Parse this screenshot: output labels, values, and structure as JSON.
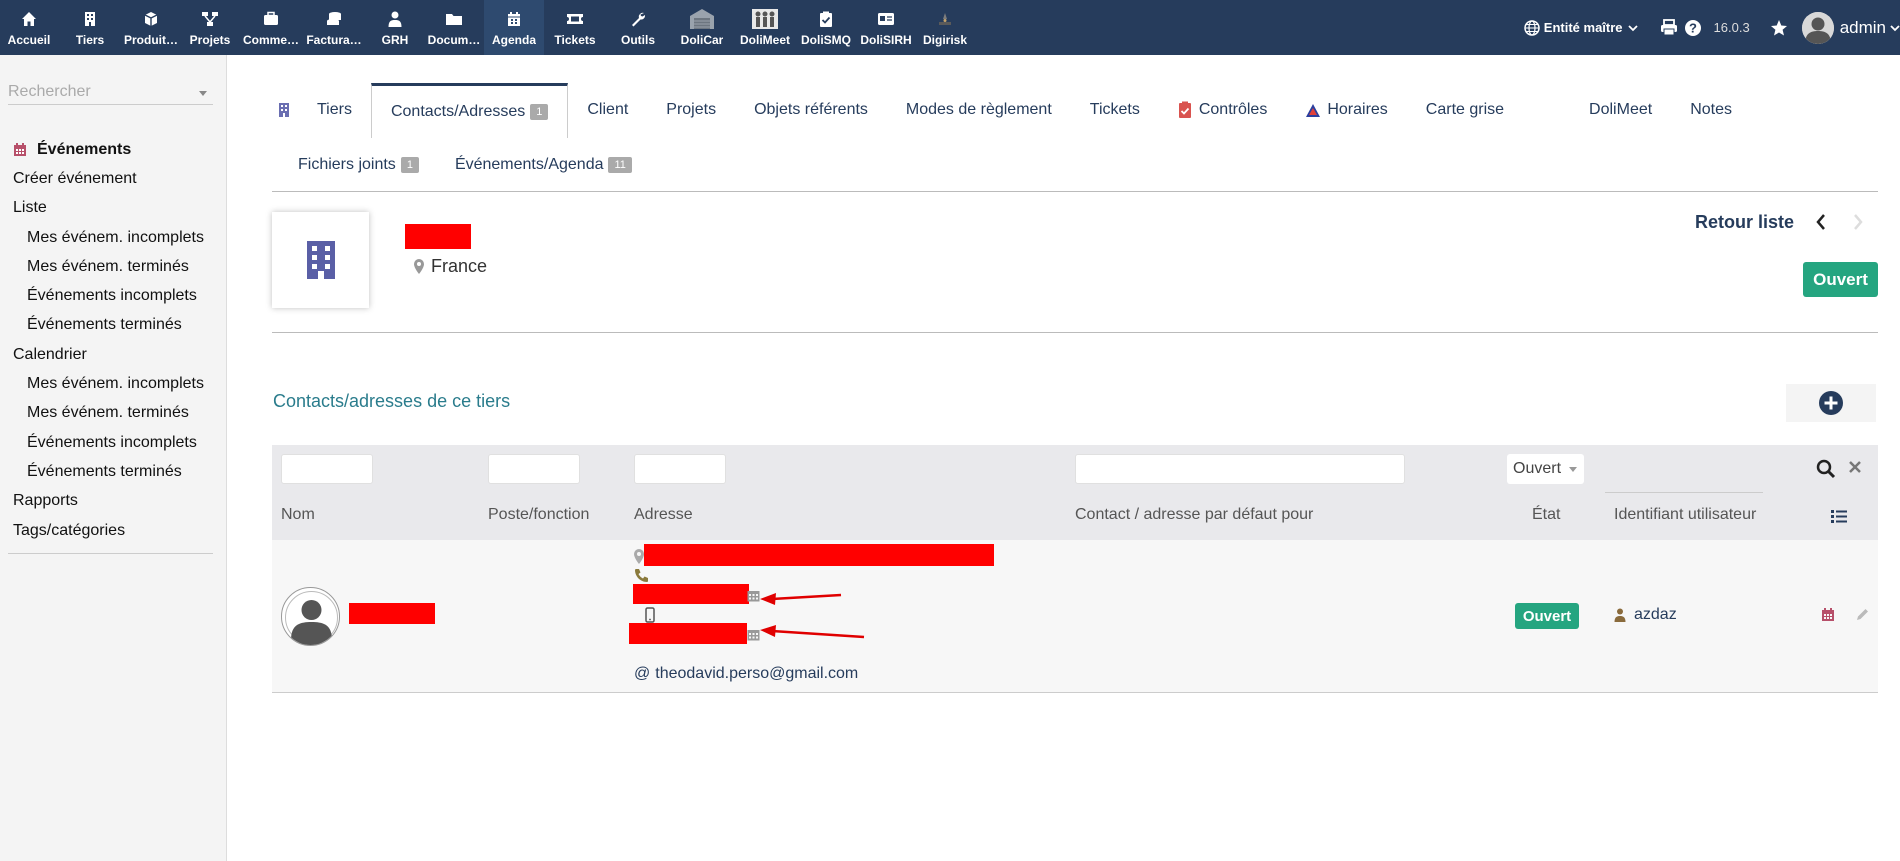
{
  "topmenu": [
    {
      "label": "Accueil",
      "icon": "home-icon"
    },
    {
      "label": "Tiers",
      "icon": "building-icon"
    },
    {
      "label": "Produit…",
      "icon": "cube-icon"
    },
    {
      "label": "Projets",
      "icon": "project-icon"
    },
    {
      "label": "Comme…",
      "icon": "suitcase-icon"
    },
    {
      "label": "Factura…",
      "icon": "coins-icon"
    },
    {
      "label": "GRH",
      "icon": "user-tie-icon"
    },
    {
      "label": "Docum…",
      "icon": "folder-icon"
    },
    {
      "label": "Agenda",
      "icon": "calendar-icon"
    },
    {
      "label": "Tickets",
      "icon": "ticket-icon"
    },
    {
      "label": "Outils",
      "icon": "wrench-icon"
    },
    {
      "label": "DoliCar",
      "icon": "garage-icon"
    },
    {
      "label": "DoliMeet",
      "icon": "meeting-icon"
    },
    {
      "label": "DoliSMQ",
      "icon": "clipboard-check-icon"
    },
    {
      "label": "DoliSIRH",
      "icon": "id-card-icon"
    },
    {
      "label": "Digirisk",
      "icon": "digirisk-icon"
    }
  ],
  "topright": {
    "entity": "Entité maître",
    "version": "16.0.3",
    "user": "admin"
  },
  "sidebar": {
    "search_placeholder": "Rechercher",
    "items": [
      {
        "label": "Événements"
      },
      {
        "label": "Créer événement"
      },
      {
        "label": "Liste"
      },
      {
        "label": "Mes événem. incomplets"
      },
      {
        "label": "Mes événem. terminés"
      },
      {
        "label": "Événements incomplets"
      },
      {
        "label": "Événements terminés"
      },
      {
        "label": "Calendrier"
      },
      {
        "label": "Mes événem. incomplets"
      },
      {
        "label": "Mes événem. terminés"
      },
      {
        "label": "Événements incomplets"
      },
      {
        "label": "Événements terminés"
      },
      {
        "label": "Rapports"
      },
      {
        "label": "Tags/catégories"
      }
    ]
  },
  "tabs": {
    "row1": [
      {
        "label": "Tiers"
      },
      {
        "label": "Contacts/Adresses",
        "badge": "1"
      },
      {
        "label": "Client"
      },
      {
        "label": "Projets"
      },
      {
        "label": "Objets référents"
      },
      {
        "label": "Modes de règlement"
      },
      {
        "label": "Tickets"
      },
      {
        "label": "Contrôles"
      },
      {
        "label": "Horaires"
      },
      {
        "label": "Carte grise"
      },
      {
        "label": "DoliMeet"
      },
      {
        "label": "Notes"
      }
    ],
    "row2": [
      {
        "label": "Fichiers joints",
        "badge": "1"
      },
      {
        "label": "Événements/Agenda",
        "badge": "11"
      }
    ]
  },
  "banner": {
    "country": "France",
    "back_label": "Retour liste",
    "status": "Ouvert"
  },
  "section": {
    "title": "Contacts/adresses de ce tiers"
  },
  "table": {
    "filter_status": "Ouvert",
    "headers": {
      "name": "Nom",
      "poste": "Poste/fonction",
      "address": "Adresse",
      "default_for": "Contact / adresse par défaut pour",
      "state": "État",
      "user_id": "Identifiant utilisateur"
    },
    "rows": [
      {
        "email": "theodavid.perso@gmail.com",
        "state": "Ouvert",
        "user": "azdaz"
      }
    ]
  },
  "colors": {
    "topbar": "#263c5c",
    "accent": "#263c5c",
    "status_green": "#25a580",
    "section_title": "#2a7c8c",
    "redaction": "#ff0000",
    "arrow": "#e00000"
  }
}
